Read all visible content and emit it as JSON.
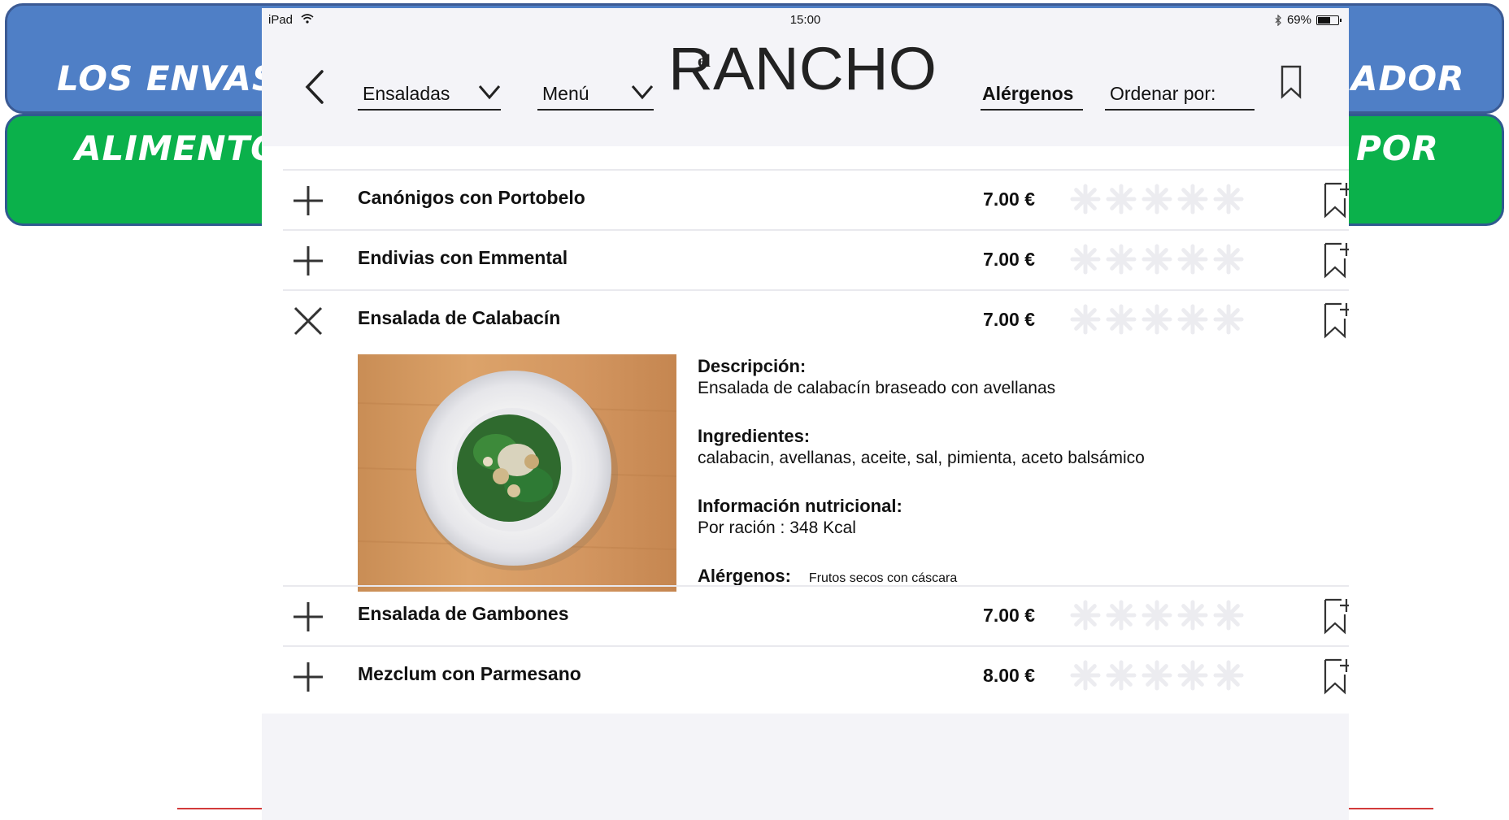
{
  "slide": {
    "line1_left": "LOS ENVAS",
    "line1_right": "ADOR",
    "line2_left": "ALIMENTO",
    "line2_right": "POR"
  },
  "statusbar": {
    "device": "iPad",
    "time": "15:00",
    "battery": "69%",
    "battery_level": 0.69
  },
  "header": {
    "category_dropdown": "Ensaladas",
    "menu_dropdown": "Menú",
    "logo_small": "el",
    "logo_text": "RANCHO",
    "allergens_link": "Alérgenos",
    "sort_label": "Ordenar por:"
  },
  "items": [
    {
      "name": "Canónigos con Portobelo",
      "price": "7.00 €",
      "expanded": false
    },
    {
      "name": "Endivias con Emmental",
      "price": "7.00 €",
      "expanded": false
    },
    {
      "name": "Ensalada de Calabacín",
      "price": "7.00 €",
      "expanded": true
    },
    {
      "name": "Ensalada de Gambones",
      "price": "7.00 €",
      "expanded": false
    },
    {
      "name": "Mezclum con Parmesano",
      "price": "8.00 €",
      "expanded": false
    }
  ],
  "detail": {
    "description_label": "Descripción:",
    "description": "Ensalada de calabacín braseado con avellanas",
    "ingredients_label": "Ingredientes:",
    "ingredients": "calabacin, avellanas, aceite, sal, pimienta, aceto balsámico",
    "nutrition_label": "Información nutricional:",
    "nutrition": "Por ración : 348 Kcal",
    "allergens_label": "Alérgenos:",
    "allergens": "Frutos secos con cáscara"
  },
  "colors": {
    "banner_blue": "#4f7fc6",
    "banner_green": "#0bb14b",
    "nav_bg": "#f4f4f8",
    "star_empty": "#ececf0"
  },
  "icons": {
    "expand": "plus-icon",
    "collapse": "close-x-icon",
    "bookmark_add": "bookmark-plus-icon",
    "rating": "asterisk-star-icon"
  }
}
